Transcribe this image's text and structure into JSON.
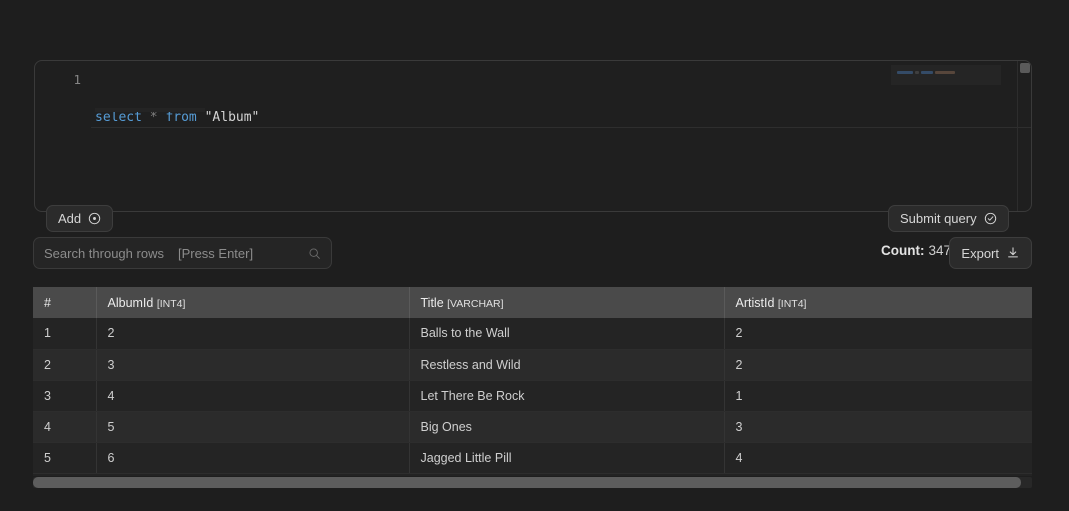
{
  "editor": {
    "line_numbers": [
      "1"
    ],
    "query_tokens": [
      {
        "text": "select",
        "type": "keyword"
      },
      {
        "text": " ",
        "type": "plain"
      },
      {
        "text": "*",
        "type": "operator"
      },
      {
        "text": " ",
        "type": "plain"
      },
      {
        "text": "from",
        "type": "keyword"
      },
      {
        "text": " ",
        "type": "plain"
      },
      {
        "text": "\"Album\"",
        "type": "identifier"
      }
    ],
    "query_text": "select * from \"Album\"",
    "colors": {
      "keyword": "#569cd6",
      "operator": "#808080",
      "identifier": "#d4d4d4",
      "background": "#1f1f1f"
    }
  },
  "toolbar": {
    "add_label": "Add",
    "add_icon": "circle-dot-icon",
    "submit_label": "Submit query",
    "submit_icon": "circle-check-icon"
  },
  "search": {
    "placeholder": "Search through rows",
    "hint": "[Press Enter]",
    "value": "",
    "icon": "search-icon"
  },
  "results_meta": {
    "count_label": "Count:",
    "count_value": "347",
    "export_label": "Export",
    "export_icon": "download-icon"
  },
  "table": {
    "columns": [
      {
        "name": "#",
        "type": ""
      },
      {
        "name": "AlbumId",
        "type": "[INT4]"
      },
      {
        "name": "Title",
        "type": "[VARCHAR]"
      },
      {
        "name": "ArtistId",
        "type": "[INT4]"
      }
    ],
    "rows": [
      {
        "idx": "1",
        "album_id": "2",
        "title": "Balls to the Wall",
        "artist_id": "2"
      },
      {
        "idx": "2",
        "album_id": "3",
        "title": "Restless and Wild",
        "artist_id": "2"
      },
      {
        "idx": "3",
        "album_id": "4",
        "title": "Let There Be Rock",
        "artist_id": "1"
      },
      {
        "idx": "4",
        "album_id": "5",
        "title": "Big Ones",
        "artist_id": "3"
      },
      {
        "idx": "5",
        "album_id": "6",
        "title": "Jagged Little Pill",
        "artist_id": "4"
      }
    ]
  },
  "theme": {
    "page_background": "#1e1e1e",
    "panel_background": "#232323",
    "header_background": "#4a4a4a",
    "row_odd": "#242424",
    "row_even": "#2b2b2b",
    "text_primary": "#d6d6d6",
    "text_muted": "#8c8c8c",
    "scrollbar_thumb": "#5d5d5d"
  }
}
